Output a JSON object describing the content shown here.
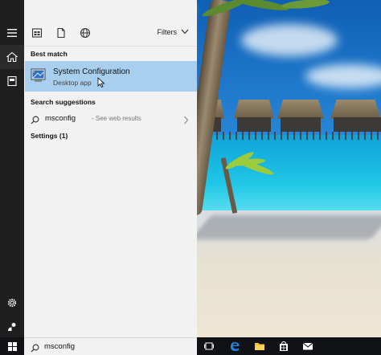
{
  "toolbar": {
    "icons": [
      "apps-icon",
      "documents-icon",
      "web-icon"
    ],
    "filters_label": "Filters"
  },
  "results": {
    "best_match_heading": "Best match",
    "best_match": {
      "name": "System Configuration",
      "type": "Desktop app",
      "icon": "system-configuration-icon"
    },
    "suggestions_heading": "Search suggestions",
    "suggestion": {
      "query": "msconfig",
      "hint": "- See web results"
    },
    "settings_heading": "Settings (1)"
  },
  "search_box": {
    "value": "msconfig"
  },
  "rail": {
    "items": [
      "hamburger-menu-icon",
      "home-icon",
      "notebook-icon",
      "settings-gear-icon",
      "feedback-icon"
    ]
  },
  "taskbar": {
    "items": [
      "start-windows-icon",
      "task-view-icon",
      "edge-browser-icon",
      "file-explorer-icon",
      "store-icon",
      "mail-icon"
    ]
  },
  "colors": {
    "selected_result": "#a9cfee",
    "panel_background": "#f2f2f2",
    "rail_background": "#1f1f1f",
    "taskbar_background": "#101216"
  }
}
